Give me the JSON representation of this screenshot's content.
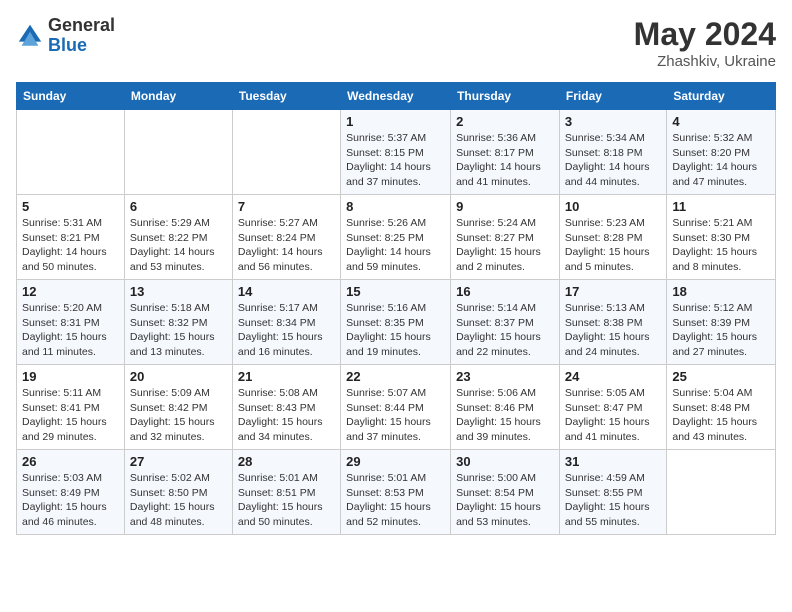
{
  "logo": {
    "general": "General",
    "blue": "Blue"
  },
  "title": {
    "month": "May 2024",
    "location": "Zhashkiv, Ukraine"
  },
  "weekdays": [
    "Sunday",
    "Monday",
    "Tuesday",
    "Wednesday",
    "Thursday",
    "Friday",
    "Saturday"
  ],
  "weeks": [
    [
      {
        "day": "",
        "info": ""
      },
      {
        "day": "",
        "info": ""
      },
      {
        "day": "",
        "info": ""
      },
      {
        "day": "1",
        "info": "Sunrise: 5:37 AM\nSunset: 8:15 PM\nDaylight: 14 hours\nand 37 minutes."
      },
      {
        "day": "2",
        "info": "Sunrise: 5:36 AM\nSunset: 8:17 PM\nDaylight: 14 hours\nand 41 minutes."
      },
      {
        "day": "3",
        "info": "Sunrise: 5:34 AM\nSunset: 8:18 PM\nDaylight: 14 hours\nand 44 minutes."
      },
      {
        "day": "4",
        "info": "Sunrise: 5:32 AM\nSunset: 8:20 PM\nDaylight: 14 hours\nand 47 minutes."
      }
    ],
    [
      {
        "day": "5",
        "info": "Sunrise: 5:31 AM\nSunset: 8:21 PM\nDaylight: 14 hours\nand 50 minutes."
      },
      {
        "day": "6",
        "info": "Sunrise: 5:29 AM\nSunset: 8:22 PM\nDaylight: 14 hours\nand 53 minutes."
      },
      {
        "day": "7",
        "info": "Sunrise: 5:27 AM\nSunset: 8:24 PM\nDaylight: 14 hours\nand 56 minutes."
      },
      {
        "day": "8",
        "info": "Sunrise: 5:26 AM\nSunset: 8:25 PM\nDaylight: 14 hours\nand 59 minutes."
      },
      {
        "day": "9",
        "info": "Sunrise: 5:24 AM\nSunset: 8:27 PM\nDaylight: 15 hours\nand 2 minutes."
      },
      {
        "day": "10",
        "info": "Sunrise: 5:23 AM\nSunset: 8:28 PM\nDaylight: 15 hours\nand 5 minutes."
      },
      {
        "day": "11",
        "info": "Sunrise: 5:21 AM\nSunset: 8:30 PM\nDaylight: 15 hours\nand 8 minutes."
      }
    ],
    [
      {
        "day": "12",
        "info": "Sunrise: 5:20 AM\nSunset: 8:31 PM\nDaylight: 15 hours\nand 11 minutes."
      },
      {
        "day": "13",
        "info": "Sunrise: 5:18 AM\nSunset: 8:32 PM\nDaylight: 15 hours\nand 13 minutes."
      },
      {
        "day": "14",
        "info": "Sunrise: 5:17 AM\nSunset: 8:34 PM\nDaylight: 15 hours\nand 16 minutes."
      },
      {
        "day": "15",
        "info": "Sunrise: 5:16 AM\nSunset: 8:35 PM\nDaylight: 15 hours\nand 19 minutes."
      },
      {
        "day": "16",
        "info": "Sunrise: 5:14 AM\nSunset: 8:37 PM\nDaylight: 15 hours\nand 22 minutes."
      },
      {
        "day": "17",
        "info": "Sunrise: 5:13 AM\nSunset: 8:38 PM\nDaylight: 15 hours\nand 24 minutes."
      },
      {
        "day": "18",
        "info": "Sunrise: 5:12 AM\nSunset: 8:39 PM\nDaylight: 15 hours\nand 27 minutes."
      }
    ],
    [
      {
        "day": "19",
        "info": "Sunrise: 5:11 AM\nSunset: 8:41 PM\nDaylight: 15 hours\nand 29 minutes."
      },
      {
        "day": "20",
        "info": "Sunrise: 5:09 AM\nSunset: 8:42 PM\nDaylight: 15 hours\nand 32 minutes."
      },
      {
        "day": "21",
        "info": "Sunrise: 5:08 AM\nSunset: 8:43 PM\nDaylight: 15 hours\nand 34 minutes."
      },
      {
        "day": "22",
        "info": "Sunrise: 5:07 AM\nSunset: 8:44 PM\nDaylight: 15 hours\nand 37 minutes."
      },
      {
        "day": "23",
        "info": "Sunrise: 5:06 AM\nSunset: 8:46 PM\nDaylight: 15 hours\nand 39 minutes."
      },
      {
        "day": "24",
        "info": "Sunrise: 5:05 AM\nSunset: 8:47 PM\nDaylight: 15 hours\nand 41 minutes."
      },
      {
        "day": "25",
        "info": "Sunrise: 5:04 AM\nSunset: 8:48 PM\nDaylight: 15 hours\nand 43 minutes."
      }
    ],
    [
      {
        "day": "26",
        "info": "Sunrise: 5:03 AM\nSunset: 8:49 PM\nDaylight: 15 hours\nand 46 minutes."
      },
      {
        "day": "27",
        "info": "Sunrise: 5:02 AM\nSunset: 8:50 PM\nDaylight: 15 hours\nand 48 minutes."
      },
      {
        "day": "28",
        "info": "Sunrise: 5:01 AM\nSunset: 8:51 PM\nDaylight: 15 hours\nand 50 minutes."
      },
      {
        "day": "29",
        "info": "Sunrise: 5:01 AM\nSunset: 8:53 PM\nDaylight: 15 hours\nand 52 minutes."
      },
      {
        "day": "30",
        "info": "Sunrise: 5:00 AM\nSunset: 8:54 PM\nDaylight: 15 hours\nand 53 minutes."
      },
      {
        "day": "31",
        "info": "Sunrise: 4:59 AM\nSunset: 8:55 PM\nDaylight: 15 hours\nand 55 minutes."
      },
      {
        "day": "",
        "info": ""
      }
    ]
  ]
}
